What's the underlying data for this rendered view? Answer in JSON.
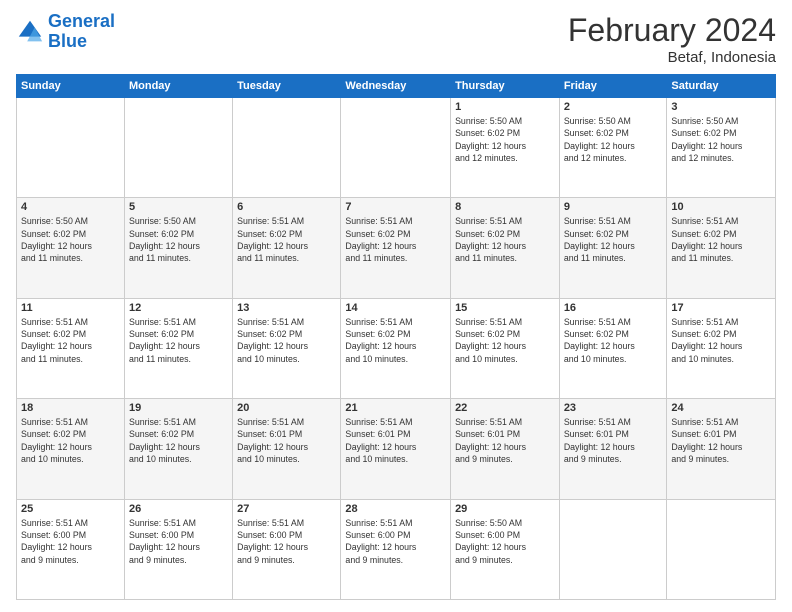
{
  "logo": {
    "line1": "General",
    "line2": "Blue"
  },
  "header": {
    "title": "February 2024",
    "subtitle": "Betaf, Indonesia"
  },
  "weekdays": [
    "Sunday",
    "Monday",
    "Tuesday",
    "Wednesday",
    "Thursday",
    "Friday",
    "Saturday"
  ],
  "weeks": [
    [
      {
        "day": "",
        "info": ""
      },
      {
        "day": "",
        "info": ""
      },
      {
        "day": "",
        "info": ""
      },
      {
        "day": "",
        "info": ""
      },
      {
        "day": "1",
        "info": "Sunrise: 5:50 AM\nSunset: 6:02 PM\nDaylight: 12 hours\nand 12 minutes."
      },
      {
        "day": "2",
        "info": "Sunrise: 5:50 AM\nSunset: 6:02 PM\nDaylight: 12 hours\nand 12 minutes."
      },
      {
        "day": "3",
        "info": "Sunrise: 5:50 AM\nSunset: 6:02 PM\nDaylight: 12 hours\nand 12 minutes."
      }
    ],
    [
      {
        "day": "4",
        "info": "Sunrise: 5:50 AM\nSunset: 6:02 PM\nDaylight: 12 hours\nand 11 minutes."
      },
      {
        "day": "5",
        "info": "Sunrise: 5:50 AM\nSunset: 6:02 PM\nDaylight: 12 hours\nand 11 minutes."
      },
      {
        "day": "6",
        "info": "Sunrise: 5:51 AM\nSunset: 6:02 PM\nDaylight: 12 hours\nand 11 minutes."
      },
      {
        "day": "7",
        "info": "Sunrise: 5:51 AM\nSunset: 6:02 PM\nDaylight: 12 hours\nand 11 minutes."
      },
      {
        "day": "8",
        "info": "Sunrise: 5:51 AM\nSunset: 6:02 PM\nDaylight: 12 hours\nand 11 minutes."
      },
      {
        "day": "9",
        "info": "Sunrise: 5:51 AM\nSunset: 6:02 PM\nDaylight: 12 hours\nand 11 minutes."
      },
      {
        "day": "10",
        "info": "Sunrise: 5:51 AM\nSunset: 6:02 PM\nDaylight: 12 hours\nand 11 minutes."
      }
    ],
    [
      {
        "day": "11",
        "info": "Sunrise: 5:51 AM\nSunset: 6:02 PM\nDaylight: 12 hours\nand 11 minutes."
      },
      {
        "day": "12",
        "info": "Sunrise: 5:51 AM\nSunset: 6:02 PM\nDaylight: 12 hours\nand 11 minutes."
      },
      {
        "day": "13",
        "info": "Sunrise: 5:51 AM\nSunset: 6:02 PM\nDaylight: 12 hours\nand 10 minutes."
      },
      {
        "day": "14",
        "info": "Sunrise: 5:51 AM\nSunset: 6:02 PM\nDaylight: 12 hours\nand 10 minutes."
      },
      {
        "day": "15",
        "info": "Sunrise: 5:51 AM\nSunset: 6:02 PM\nDaylight: 12 hours\nand 10 minutes."
      },
      {
        "day": "16",
        "info": "Sunrise: 5:51 AM\nSunset: 6:02 PM\nDaylight: 12 hours\nand 10 minutes."
      },
      {
        "day": "17",
        "info": "Sunrise: 5:51 AM\nSunset: 6:02 PM\nDaylight: 12 hours\nand 10 minutes."
      }
    ],
    [
      {
        "day": "18",
        "info": "Sunrise: 5:51 AM\nSunset: 6:02 PM\nDaylight: 12 hours\nand 10 minutes."
      },
      {
        "day": "19",
        "info": "Sunrise: 5:51 AM\nSunset: 6:02 PM\nDaylight: 12 hours\nand 10 minutes."
      },
      {
        "day": "20",
        "info": "Sunrise: 5:51 AM\nSunset: 6:01 PM\nDaylight: 12 hours\nand 10 minutes."
      },
      {
        "day": "21",
        "info": "Sunrise: 5:51 AM\nSunset: 6:01 PM\nDaylight: 12 hours\nand 10 minutes."
      },
      {
        "day": "22",
        "info": "Sunrise: 5:51 AM\nSunset: 6:01 PM\nDaylight: 12 hours\nand 9 minutes."
      },
      {
        "day": "23",
        "info": "Sunrise: 5:51 AM\nSunset: 6:01 PM\nDaylight: 12 hours\nand 9 minutes."
      },
      {
        "day": "24",
        "info": "Sunrise: 5:51 AM\nSunset: 6:01 PM\nDaylight: 12 hours\nand 9 minutes."
      }
    ],
    [
      {
        "day": "25",
        "info": "Sunrise: 5:51 AM\nSunset: 6:00 PM\nDaylight: 12 hours\nand 9 minutes."
      },
      {
        "day": "26",
        "info": "Sunrise: 5:51 AM\nSunset: 6:00 PM\nDaylight: 12 hours\nand 9 minutes."
      },
      {
        "day": "27",
        "info": "Sunrise: 5:51 AM\nSunset: 6:00 PM\nDaylight: 12 hours\nand 9 minutes."
      },
      {
        "day": "28",
        "info": "Sunrise: 5:51 AM\nSunset: 6:00 PM\nDaylight: 12 hours\nand 9 minutes."
      },
      {
        "day": "29",
        "info": "Sunrise: 5:50 AM\nSunset: 6:00 PM\nDaylight: 12 hours\nand 9 minutes."
      },
      {
        "day": "",
        "info": ""
      },
      {
        "day": "",
        "info": ""
      }
    ]
  ]
}
